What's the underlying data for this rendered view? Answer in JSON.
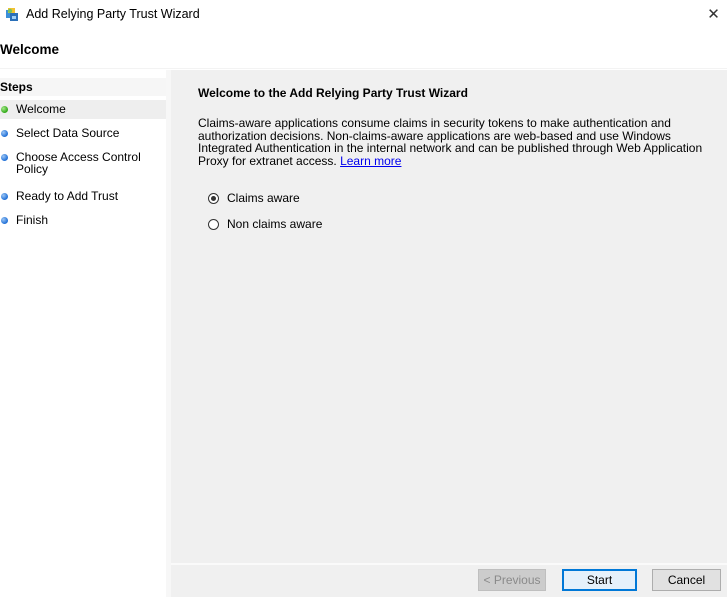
{
  "window": {
    "title": "Add Relying Party Trust Wizard",
    "icon": "wizard-app-icon",
    "close_icon": "close-icon",
    "close_glyph": "✕"
  },
  "page_header": "Welcome",
  "sidebar": {
    "header": "Steps",
    "steps": [
      {
        "label": "Welcome",
        "status": "current",
        "dot_color": "#2fa816"
      },
      {
        "label": "Select Data Source",
        "status": "pending",
        "dot_color": "#1e6ed6"
      },
      {
        "label": "Choose Access Control Policy",
        "label_line1": "Choose Access Control",
        "label_line2": "Policy",
        "status": "pending",
        "dot_color": "#1e6ed6"
      },
      {
        "label": "Ready to Add Trust",
        "status": "pending",
        "dot_color": "#1e6ed6"
      },
      {
        "label": "Finish",
        "status": "pending",
        "dot_color": "#1e6ed6"
      }
    ]
  },
  "main": {
    "title": "Welcome to the Add Relying Party Trust Wizard",
    "description_lines": [
      "Claims-aware applications consume claims in security tokens to make authentication and",
      "authorization decisions. Non-claims-aware applications are web-based and use Windows",
      "Integrated Authentication in the internal network and can be published through Web Application",
      "Proxy for extranet access."
    ],
    "learn_more": "Learn more",
    "options": [
      {
        "label": "Claims aware",
        "selected": true
      },
      {
        "label": "Non claims aware",
        "selected": false
      }
    ]
  },
  "buttons": {
    "previous": {
      "label": "< Previous",
      "enabled": false
    },
    "start": {
      "label": "Start",
      "enabled": true,
      "default": true
    },
    "cancel": {
      "label": "Cancel",
      "enabled": true
    }
  },
  "colors": {
    "accent": "#0078d7",
    "link": "#0000ee",
    "panel_bg": "#f0f0f0"
  }
}
